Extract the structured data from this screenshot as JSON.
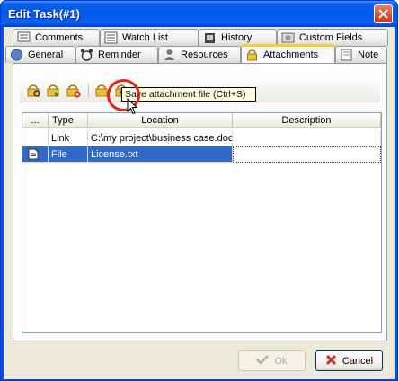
{
  "window": {
    "title": "Edit Task(#1)"
  },
  "tabs_row1": [
    {
      "label": "Comments",
      "icon": "comments-icon"
    },
    {
      "label": "Watch List",
      "icon": "watch-list-icon"
    },
    {
      "label": "History",
      "icon": "history-icon"
    },
    {
      "label": "Custom Fields",
      "icon": "custom-fields-icon"
    }
  ],
  "tabs_row2": [
    {
      "label": "General",
      "icon": "general-icon"
    },
    {
      "label": "Reminder",
      "icon": "alarm-clock-icon"
    },
    {
      "label": "Resources",
      "icon": "resources-icon"
    },
    {
      "label": "Attachments",
      "icon": "attachment-lock-icon",
      "active": true
    },
    {
      "label": "Note",
      "icon": "note-icon"
    }
  ],
  "toolbar": {
    "buttons": [
      "open-attachment-icon",
      "add-attachment-icon",
      "delete-attachment-icon",
      "lock-attachment-icon",
      "save-attachment-icon"
    ],
    "tooltip": "Save attachment file (Ctrl+S)"
  },
  "grid": {
    "columns": [
      "...",
      "Type",
      "Location",
      "Description"
    ],
    "rows": [
      {
        "marker": "",
        "type": "Link",
        "location": "C:\\my project\\business case.doc",
        "description": ""
      },
      {
        "marker": "file-icon",
        "type": "File",
        "location": "License.txt",
        "description": "",
        "selected": true
      }
    ]
  },
  "buttons": {
    "ok": "Ok",
    "cancel": "Cancel"
  },
  "colors": {
    "title_bar": "#0058e6",
    "selection": "#316ac5",
    "highlight_ring": "#e8231b",
    "tab_active_top": "#ffc83c"
  }
}
